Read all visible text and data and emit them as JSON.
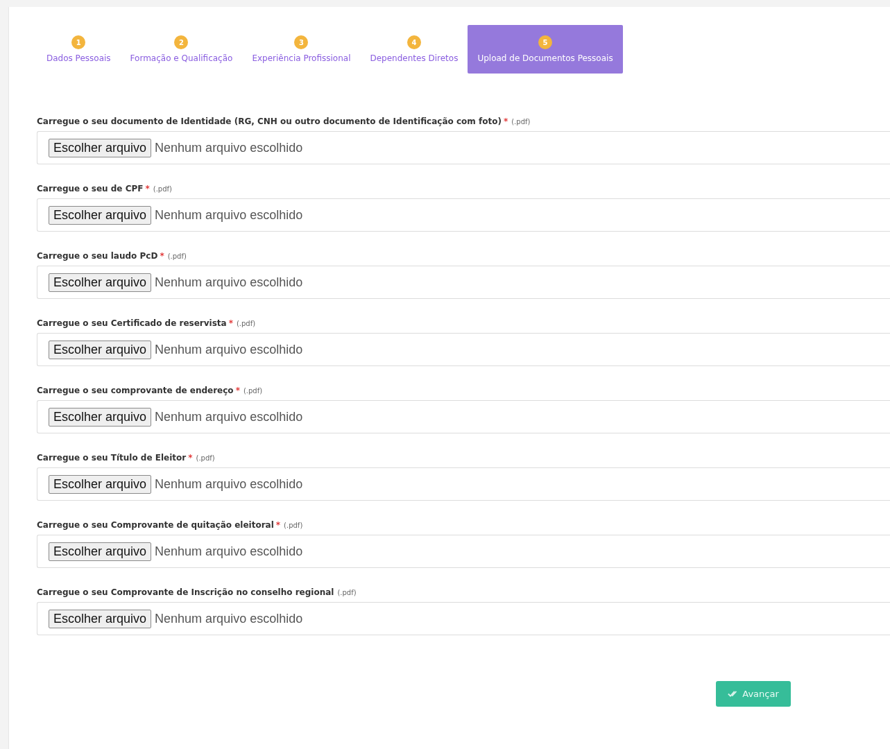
{
  "steps": [
    {
      "number": "1",
      "label": "Dados Pessoais",
      "selected": false
    },
    {
      "number": "2",
      "label": "Formação e Qualificação",
      "selected": false
    },
    {
      "number": "3",
      "label": "Experiência Profissional",
      "selected": false
    },
    {
      "number": "4",
      "label": "Dependentes Diretos",
      "selected": false
    },
    {
      "number": "5",
      "label": "Upload de Documentos Pessoais",
      "selected": true
    }
  ],
  "uploads": [
    {
      "label": "Carregue o seu documento de Identidade (RG, CNH ou outro documento de Identificação com foto)",
      "required_mark": "*",
      "hint": "(.pdf)",
      "button": "Escolher arquivo",
      "status": "Nenhum arquivo escolhido"
    },
    {
      "label": "Carregue o seu de CPF",
      "required_mark": "*",
      "hint": "(.pdf)",
      "button": "Escolher arquivo",
      "status": "Nenhum arquivo escolhido"
    },
    {
      "label": "Carregue o seu laudo PcD",
      "required_mark": "*",
      "hint": "(.pdf)",
      "button": "Escolher arquivo",
      "status": "Nenhum arquivo escolhido"
    },
    {
      "label": "Carregue o seu Certificado de reservista",
      "required_mark": "*",
      "hint": "(.pdf)",
      "button": "Escolher arquivo",
      "status": "Nenhum arquivo escolhido"
    },
    {
      "label": "Carregue o seu comprovante de endereço",
      "required_mark": "*",
      "hint": "(.pdf)",
      "button": "Escolher arquivo",
      "status": "Nenhum arquivo escolhido"
    },
    {
      "label": "Carregue o seu Título de Eleitor",
      "required_mark": "*",
      "hint": "(.pdf)",
      "button": "Escolher arquivo",
      "status": "Nenhum arquivo escolhido"
    },
    {
      "label": "Carregue o seu Comprovante de quitação eleitoral",
      "required_mark": "*",
      "hint": "(.pdf)",
      "button": "Escolher arquivo",
      "status": "Nenhum arquivo escolhido"
    },
    {
      "label": "Carregue o seu Comprovante de Inscrição no conselho regional",
      "hint": "(.pdf)",
      "button": "Escolher arquivo",
      "status": "Nenhum arquivo escolhido"
    }
  ],
  "submit": {
    "label": "Avançar"
  }
}
